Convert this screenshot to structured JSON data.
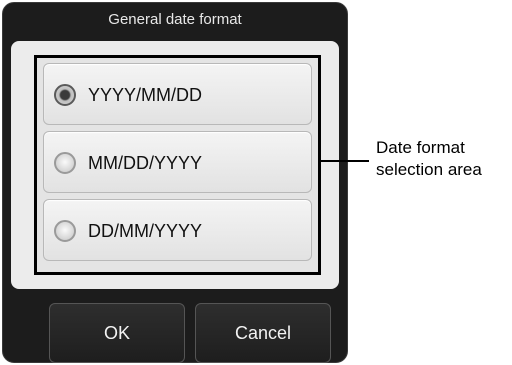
{
  "dialog": {
    "title": "General date format",
    "options": [
      {
        "label": "YYYY/MM/DD",
        "selected": true
      },
      {
        "label": "MM/DD/YYYY",
        "selected": false
      },
      {
        "label": "DD/MM/YYYY",
        "selected": false
      }
    ],
    "ok_label": "OK",
    "cancel_label": "Cancel"
  },
  "annotation": {
    "line1": "Date format",
    "line2": "selection area"
  }
}
